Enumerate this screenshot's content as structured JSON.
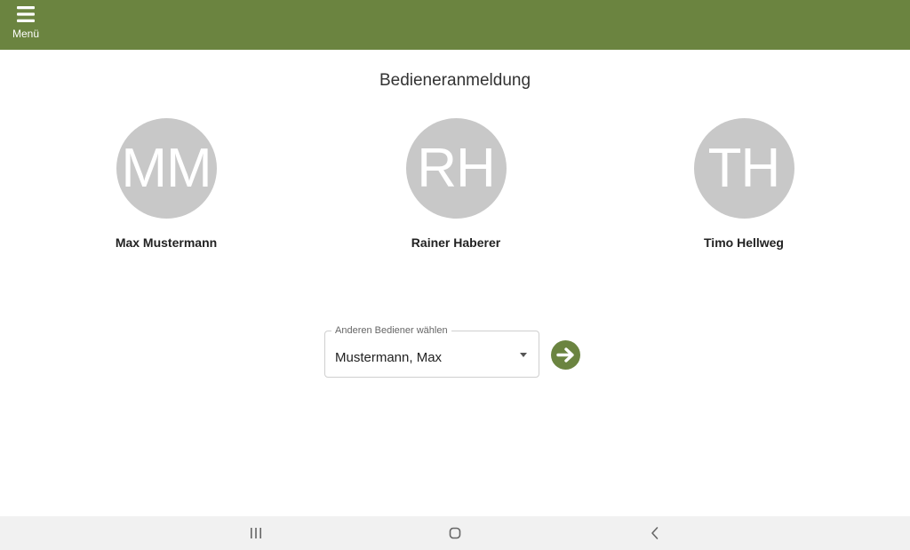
{
  "header": {
    "menu_label": "Menü",
    "background_color": "#6b8440"
  },
  "page": {
    "title": "Bedieneranmeldung"
  },
  "operators": [
    {
      "initials": "MM",
      "name": "Max Mustermann"
    },
    {
      "initials": "RH",
      "name": "Rainer Haberer"
    },
    {
      "initials": "TH",
      "name": "Timo Hellweg"
    }
  ],
  "select": {
    "label": "Anderen Bediener wählen",
    "value": "Mustermann, Max"
  },
  "icons": {
    "menu": "hamburger-icon",
    "submit": "arrow-right-circle-icon",
    "recent_apps": "recent-apps-icon",
    "home": "home-icon",
    "back": "back-icon"
  },
  "colors": {
    "accent": "#6b8440",
    "avatar": "#c8c8c8"
  }
}
